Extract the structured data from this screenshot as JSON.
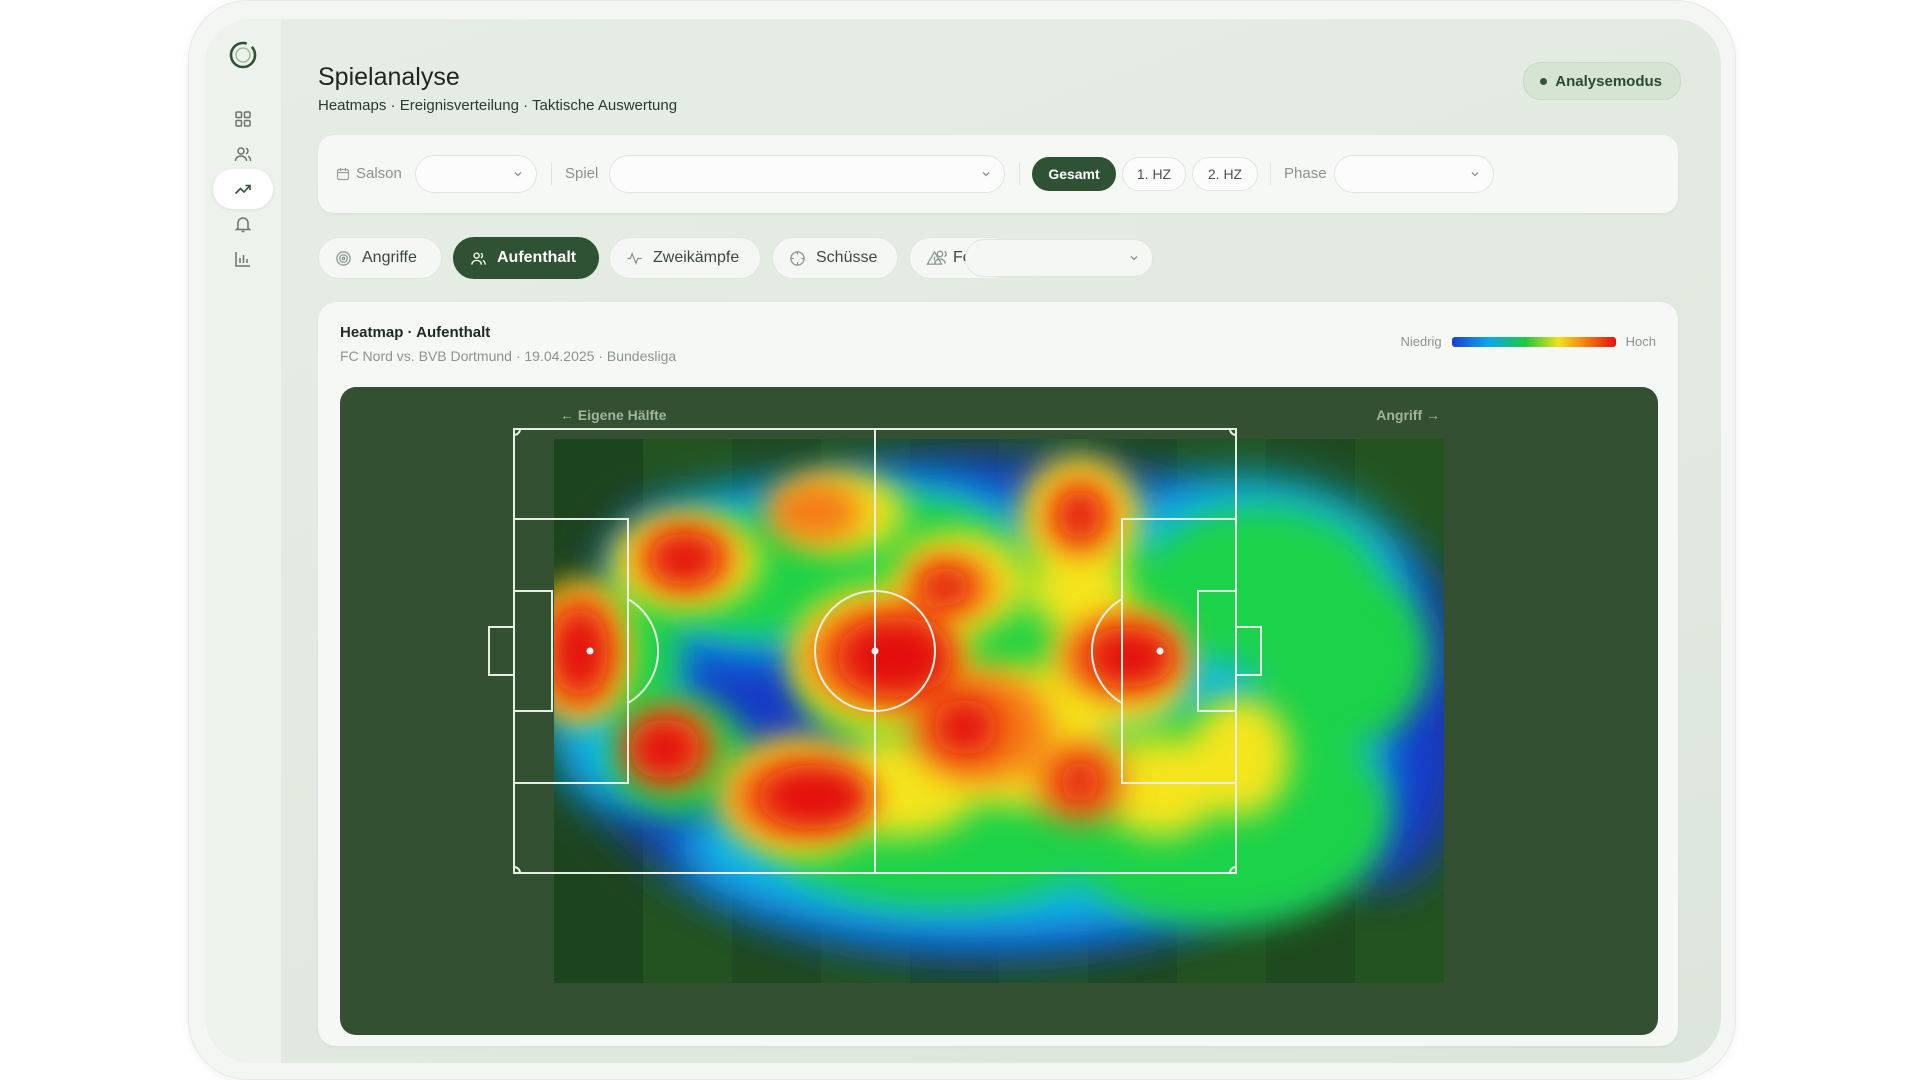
{
  "app": {
    "title": "Spielanalyse",
    "subtitle": "Heatmaps · Ereignisverteilung · Taktische Auswertung",
    "mode_label": "Analysemodus",
    "accent_color": "#2e5233"
  },
  "sidebar": {
    "items": [
      {
        "name": "dashboard",
        "icon": "grid-icon"
      },
      {
        "name": "players",
        "icon": "users-icon"
      },
      {
        "name": "analysis",
        "icon": "trend-icon",
        "active": true
      },
      {
        "name": "notifications",
        "icon": "bell-icon"
      },
      {
        "name": "statistics",
        "icon": "bar-chart-icon"
      }
    ]
  },
  "filters": {
    "season_label": "Salson",
    "season_value": "",
    "match_label": "Spiel",
    "match_value": "",
    "halves": [
      "Gesamt",
      "1. HZ",
      "2. HZ"
    ],
    "active_half": "Gesamt",
    "phase_label": "Phase",
    "phase_value": ""
  },
  "tabs": {
    "items": [
      {
        "label": "Angriffe",
        "icon": "target-icon"
      },
      {
        "label": "Aufenthalt",
        "icon": "users-icon",
        "active": true
      },
      {
        "label": "Zweikämpfe",
        "icon": "activity-icon"
      },
      {
        "label": "Schüsse",
        "icon": "crosshair-icon"
      },
      {
        "label": "Fouls",
        "icon": "warning-icon"
      }
    ],
    "player_value": ""
  },
  "heatmap": {
    "title": "Heatmap · Aufenthalt",
    "subtitle": "FC Nord vs. BVB Dortmund · 19.04.2025 · Bundesliga",
    "legend_low": "Niedrig",
    "legend_high": "Hoch",
    "left_caption": "← Eigene Hälfte",
    "right_caption": "Angriff →"
  }
}
